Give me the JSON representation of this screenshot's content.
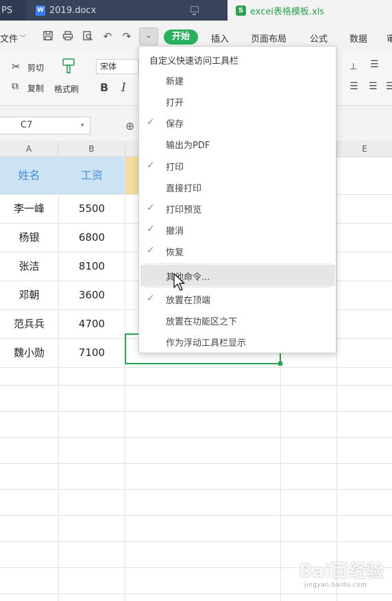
{
  "tabs": [
    {
      "label": "PS"
    },
    {
      "label": "2019.docx"
    },
    {
      "label": "excel表格模板.xls"
    }
  ],
  "menu": {
    "file_label": "文件",
    "start_tab": "开始",
    "ribbon_tabs": [
      "插入",
      "页面布局",
      "公式",
      "数据",
      "审"
    ]
  },
  "ribbon": {
    "cut_label": "剪切",
    "copy_label": "复制",
    "format_painter_label": "格式刷",
    "font_name": "宋体",
    "bold": "B",
    "italic": "I"
  },
  "formula_bar": {
    "name_box": "C7"
  },
  "columns": [
    "A",
    "B",
    "",
    "",
    "E"
  ],
  "table": {
    "headers": [
      "姓名",
      "工资"
    ],
    "rows": [
      {
        "name": "李一峰",
        "salary": "5500"
      },
      {
        "name": "杨银",
        "salary": "6800"
      },
      {
        "name": "张洁",
        "salary": "8100"
      },
      {
        "name": "邓朝",
        "salary": "3600"
      },
      {
        "name": "范兵兵",
        "salary": "4700"
      },
      {
        "name": "魏小勋",
        "salary": "7100"
      }
    ]
  },
  "qa_menu": {
    "title": "自定义快速访问工具栏",
    "items": [
      {
        "label": "新建",
        "checked": false
      },
      {
        "label": "打开",
        "checked": false
      },
      {
        "label": "保存",
        "checked": true
      },
      {
        "label": "输出为PDF",
        "checked": false
      },
      {
        "label": "打印",
        "checked": true
      },
      {
        "label": "直接打印",
        "checked": false
      },
      {
        "label": "打印预览",
        "checked": true
      },
      {
        "label": "撤消",
        "checked": true
      },
      {
        "label": "恢复",
        "checked": true
      },
      {
        "label": "其他命令...",
        "checked": false,
        "hovered": true
      },
      {
        "label": "放置在顶端",
        "checked": true
      },
      {
        "label": "放置在功能区之下",
        "checked": false
      },
      {
        "label": "作为浮动工具栏显示",
        "checked": false
      }
    ]
  },
  "check_glyph": "✓",
  "watermark": {
    "text": "Bai百经验",
    "url": "jingyan.baidu.com"
  },
  "colors": {
    "accent_green": "#2ab15c",
    "header_fill": "#cbe3f3",
    "header_text": "#4c8fd6",
    "tab_bar": "#1f2a3c"
  }
}
